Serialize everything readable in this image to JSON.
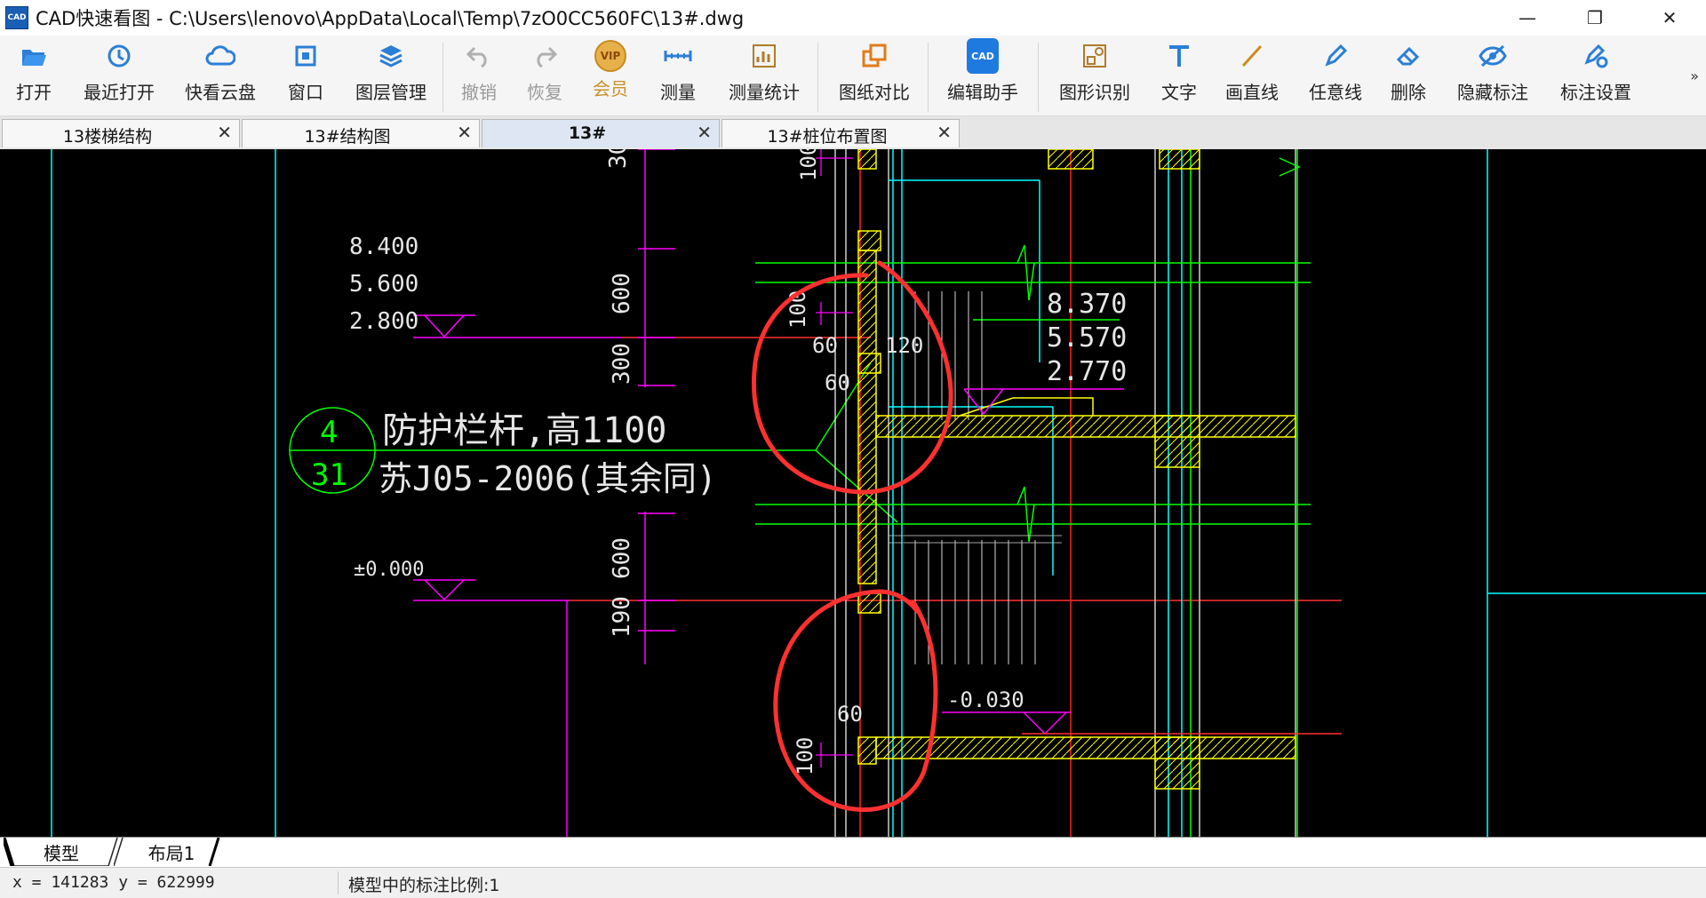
{
  "window": {
    "app_icon_text": "CAD",
    "title": "CAD快速看图 - C:\\Users\\lenovo\\AppData\\Local\\Temp\\7zO0CC560FC\\13#.dwg",
    "minimize": "—",
    "restore": "❐",
    "close": "✕"
  },
  "toolbar": {
    "open": "打开",
    "recent": "最近打开",
    "cloud": "快看云盘",
    "window": "窗口",
    "layers": "图层管理",
    "undo": "撤销",
    "redo": "恢复",
    "vip_badge": "VIP",
    "vip": "会员",
    "measure": "测量",
    "measure_stats": "测量统计",
    "compare": "图纸对比",
    "edit_assistant": "编辑助手",
    "edit_assistant_badge": "CAD",
    "shape_recognition": "图形识别",
    "text": "文字",
    "line": "画直线",
    "freehand": "任意线",
    "delete": "删除",
    "hide_annotation": "隐藏标注",
    "annotation_settings": "标注设置",
    "more": "»"
  },
  "tabs": [
    {
      "label": "13楼梯结构",
      "active": false
    },
    {
      "label": "13#结构图",
      "active": false
    },
    {
      "label": "13#",
      "active": true
    },
    {
      "label": "13#桩位布置图",
      "active": false
    }
  ],
  "tab_close_glyph": "✕",
  "drawing": {
    "elev_left": [
      "8.400",
      "5.600",
      "2.800"
    ],
    "elev_right": [
      "8.370",
      "5.570",
      "2.770"
    ],
    "elev_zero": "±0.000",
    "elev_neg": "-0.030",
    "dims_vertical_left": [
      "30",
      "600",
      "300",
      "600",
      "190"
    ],
    "dims_vertical_mid": [
      "100",
      "100",
      "100"
    ],
    "dims_small": [
      "60",
      "120",
      "60",
      "60"
    ],
    "callout_top": "4",
    "callout_bottom": "31",
    "note_line1": "防护栏杆,高1100",
    "note_line2": "苏J05-2006(其余同)"
  },
  "layout_tabs": [
    {
      "label": "模型",
      "active": true
    },
    {
      "label": "布局1",
      "active": false
    }
  ],
  "status": {
    "coords": "x = 141283 y = 622999",
    "scale": "模型中的标注比例:1"
  },
  "colors": {
    "canvas_bg": "#000000",
    "magenta": "#ff00ff",
    "cyan": "#00ffff",
    "green": "#00ff00",
    "yellow": "#ffff00",
    "red_line": "#ff2020",
    "markup_red": "#ff3030"
  }
}
